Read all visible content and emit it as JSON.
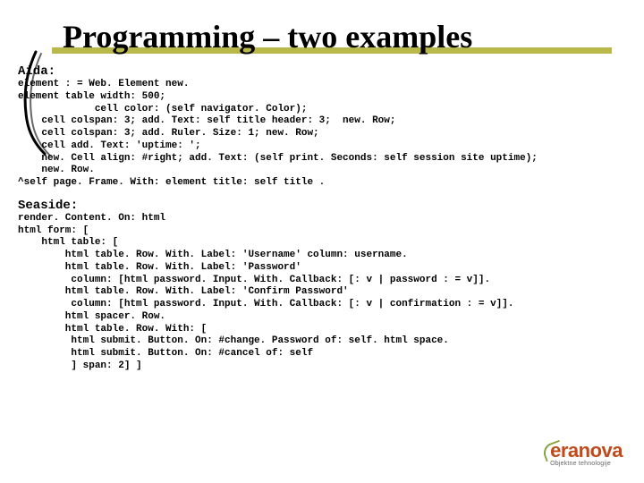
{
  "title": "Programming – two examples",
  "section1_label": "Aida:",
  "section1_code": "element : = Web. Element new.\nelement table width: 500;\n             cell color: (self navigator. Color);\n    cell colspan: 3; add. Text: self title header: 3;  new. Row;\n    cell colspan: 3; add. Ruler. Size: 1; new. Row;\n    cell add. Text: 'uptime: ';\n    new. Cell align: #right; add. Text: (self print. Seconds: self session site uptime);\n    new. Row.\n^self page. Frame. With: element title: self title .",
  "section2_label": "Seaside:",
  "section2_code": "render. Content. On: html\nhtml form: [\n    html table: [\n        html table. Row. With. Label: 'Username' column: username.\n        html table. Row. With. Label: 'Password'\n         column: [html password. Input. With. Callback: [: v | password : = v]].\n        html table. Row. With. Label: 'Confirm Password'\n         column: [html password. Input. With. Callback: [: v | confirmation : = v]].\n        html spacer. Row.\n        html table. Row. With: [\n         html submit. Button. On: #change. Password of: self. html space.\n         html submit. Button. On: #cancel of: self\n         ] span: 2] ]",
  "logo": {
    "wordmark": "eranova",
    "tagline": "Objektne tehnologije"
  }
}
